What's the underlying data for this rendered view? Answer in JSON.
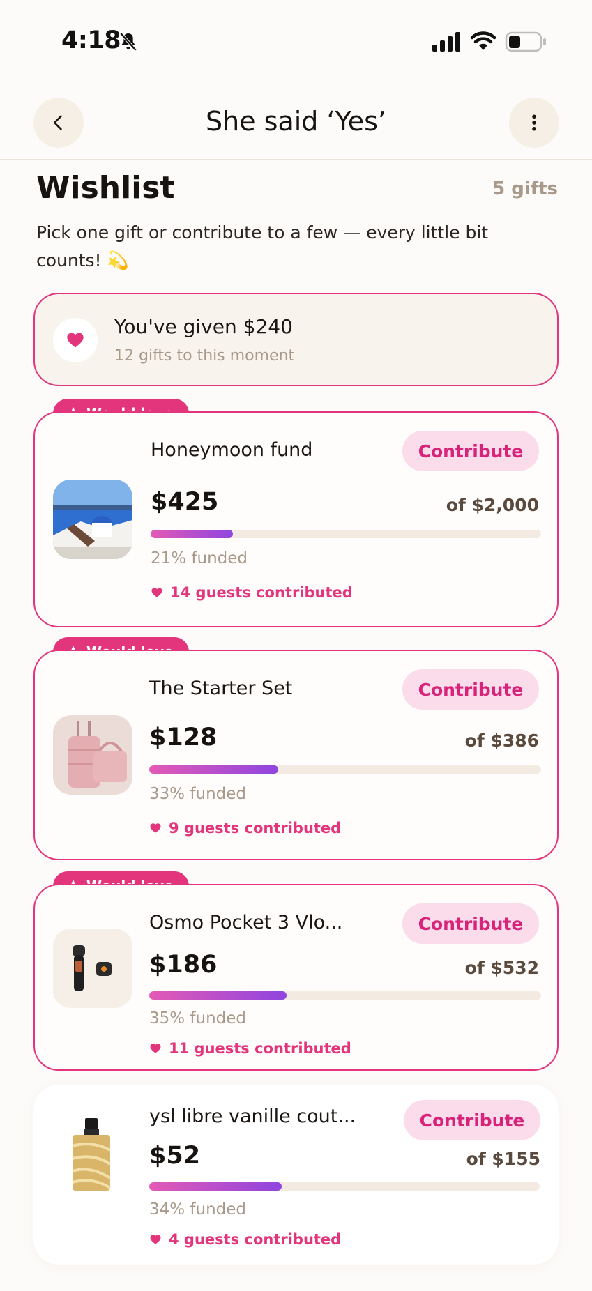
{
  "status_bar": {
    "time": "4:18",
    "icons": [
      "bell-slash-icon",
      "signal-icon",
      "wifi-icon",
      "battery-icon"
    ]
  },
  "nav": {
    "title": "She said ‘Yes’",
    "back_icon": "chevron-left-icon",
    "more_icon": "more-vertical-icon"
  },
  "wishlist": {
    "title": "Wishlist",
    "count": "5 gifts",
    "subtitle": "Pick one gift or contribute to a few — every little bit counts! 💫"
  },
  "given": {
    "title": "You've given $240",
    "subtitle": "12 gifts to this moment",
    "icon": "heart-icon"
  },
  "gifts": [
    {
      "badge": "Would love",
      "name": "Honeymoon fund",
      "button": "Contribute",
      "amount": "$425",
      "goal": "of $2,000",
      "progress": 0.21,
      "funded": "21% funded",
      "guests": "14 guests contributed",
      "image": "santorini-photo"
    },
    {
      "badge": "Would love",
      "name": "The Starter Set",
      "button": "Contribute",
      "amount": "$128",
      "goal": "of $386",
      "progress": 0.33,
      "funded": "33% funded",
      "guests": "9 guests contributed",
      "image": "pink-luggage-photo"
    },
    {
      "badge": "Would love",
      "name": "Osmo Pocket 3 Vlo...",
      "button": "Contribute",
      "amount": "$186",
      "goal": "of $532",
      "progress": 0.35,
      "funded": "35% funded",
      "guests": "11 guests contributed",
      "image": "pocket-camera-photo"
    },
    {
      "badge": "",
      "name": "ysl libre vanille cout...",
      "button": "Contribute",
      "amount": "$52",
      "goal": "of $155",
      "progress": 0.34,
      "funded": "34% funded",
      "guests": "4 guests contributed",
      "image": "perfume-bottle-photo"
    }
  ],
  "colors": {
    "accent": "#e2357c",
    "button_bg": "#fbdcea",
    "muted": "#a8998a",
    "background": "#fdfbf9"
  }
}
